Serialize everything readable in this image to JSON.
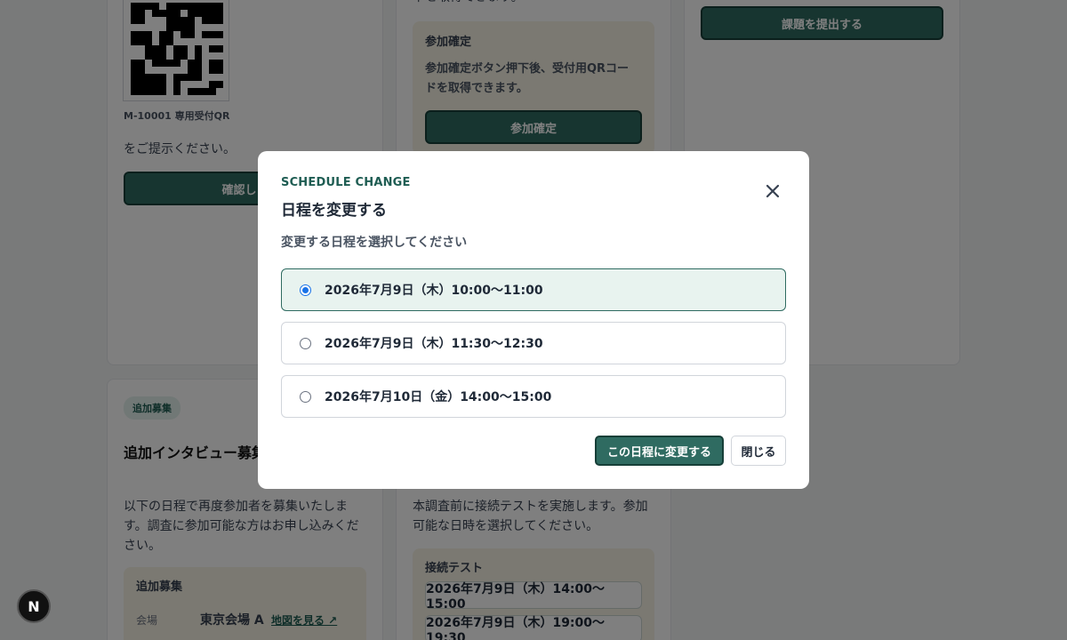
{
  "background": {
    "col1": {
      "qr_caption": "M-10001 専用受付QR",
      "instruction": "をご提示ください。",
      "confirm_button": "確認しま"
    },
    "col2": {
      "top_text": "下を取得できます。",
      "box_title": "参加確定",
      "box_desc": "参加確定ボタン押下後、受付用QRコードを取得できます。",
      "confirm_button": "参加確定"
    },
    "col3": {
      "submit_button": "課題を提出する"
    },
    "lower_left": {
      "tag": "追加募集",
      "title": "追加インタビュー募集",
      "desc": "以下の日程で再度参加者を募集いたします。調査に参加可能な方はお申し込みください。",
      "box_title": "追加募集",
      "venue_label": "会場",
      "venue_value": "東京会場 A",
      "map_link": "地図を見る ↗"
    },
    "lower_mid": {
      "desc": "本調査前に接続テストを実施します。参加可能な日時を選択してください。",
      "box_title": "接続テスト",
      "slots": [
        "2026年7月9日（木）14:00〜15:00",
        "2026年7月9日（木）19:00〜19:30"
      ]
    },
    "nav_badge": "N"
  },
  "modal": {
    "eyebrow": "SCHEDULE CHANGE",
    "title": "日程を変更する",
    "prompt": "変更する日程を選択してください",
    "options": [
      {
        "label": "2026年7月9日（木）10:00〜11:00",
        "selected": true
      },
      {
        "label": "2026年7月9日（木）11:30〜12:30",
        "selected": false
      },
      {
        "label": "2026年7月10日（金）14:00〜15:00",
        "selected": false
      }
    ],
    "primary_button": "この日程に変更する",
    "secondary_button": "閉じる",
    "close_icon": "close-icon"
  },
  "colors": {
    "accent": "#2f6b61",
    "radio_selected": "#1a73e8",
    "overlay": "rgba(0,0,0,0.5)"
  }
}
